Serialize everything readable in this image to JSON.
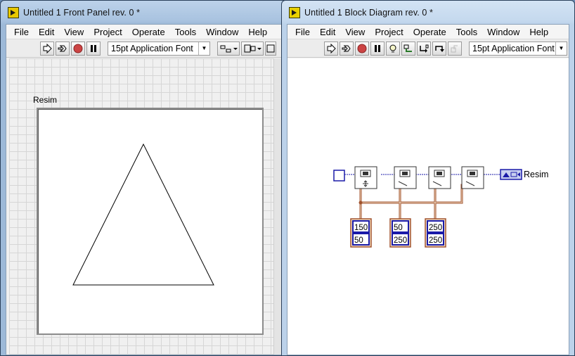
{
  "front_panel": {
    "title": "Untitled 1 Front Panel rev. 0 *",
    "menu": [
      "File",
      "Edit",
      "View",
      "Project",
      "Operate",
      "Tools",
      "Window",
      "Help"
    ],
    "font_selector": "15pt Application Font",
    "picture_label": "Resim"
  },
  "block_diagram": {
    "title": "Untitled 1 Block Diagram rev. 0 *",
    "menu": [
      "File",
      "Edit",
      "View",
      "Project",
      "Operate",
      "Tools",
      "Window",
      "Help"
    ],
    "font_selector": "15pt Application Font",
    "indicator_label": "Resim",
    "constants": [
      {
        "x": "150",
        "y": "50"
      },
      {
        "x": "50",
        "y": "250"
      },
      {
        "x": "250",
        "y": "250"
      }
    ]
  },
  "colors": {
    "wire_picture": "#1a1aa8",
    "wire_cluster": "#a0522d",
    "constant_border": "#1a1aa8"
  }
}
